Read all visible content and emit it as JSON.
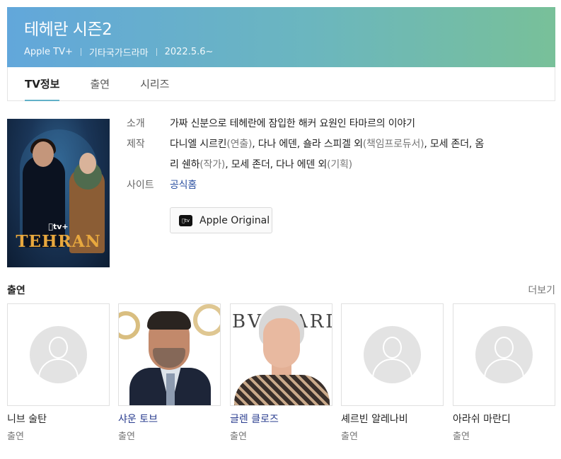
{
  "header": {
    "title": "테헤란 시즌2",
    "meta": [
      "Apple TV+",
      "기타국가드라마",
      "2022.5.6~"
    ],
    "colors": {
      "gradient_start": "#62a7db",
      "gradient_end": "#78c099"
    }
  },
  "tabs": [
    {
      "label": "TV정보",
      "active": true
    },
    {
      "label": "출연",
      "active": false
    },
    {
      "label": "시리즈",
      "active": false
    }
  ],
  "poster": {
    "brand": "tv+",
    "title": "TEHRAN"
  },
  "info": {
    "intro": {
      "label": "소개",
      "text": "가짜 신분으로 테헤란에 잠입한 해커 요원인 타마르의 이야기"
    },
    "production": {
      "label": "제작",
      "line1": {
        "p1": "다니엘 시르킨",
        "r1": "(연출)",
        "p2": ", 다나 에덴, 숄라 스피겔 외",
        "r2": "(책임프로듀서)",
        "p3": ", 모세 존더, 옴"
      },
      "line2": {
        "p1": "리 쉔하",
        "r1": "(작가)",
        "p2": ", 모세 존더, 다나 에덴 외",
        "r2": "(기획)"
      }
    },
    "site": {
      "label": "사이트",
      "link": "공식홈"
    }
  },
  "apple_button": {
    "icon": "apple-tv-icon",
    "label": "Apple Original"
  },
  "cast_section": {
    "title": "출연",
    "more": "더보기",
    "members": [
      {
        "name": "니브 술탄",
        "role": "출연",
        "photo": "placeholder"
      },
      {
        "name": "샤운 토브",
        "role": "출연",
        "photo": "photo"
      },
      {
        "name": "글렌 클로즈",
        "role": "출연",
        "photo": "photo"
      },
      {
        "name": "셰르빈 알레나비",
        "role": "출연",
        "photo": "placeholder"
      },
      {
        "name": "아라쉬 마란디",
        "role": "출연",
        "photo": "placeholder"
      }
    ]
  }
}
